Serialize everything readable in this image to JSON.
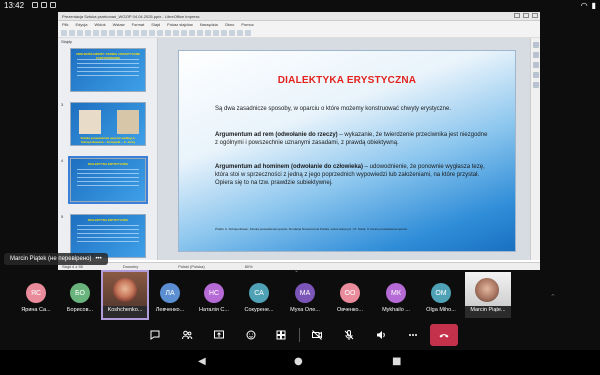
{
  "status_bar": {
    "time": "13:42"
  },
  "shared_window": {
    "title": "Prezentacja Sztuka przekonań_WOZIP 04.04.2025.pptx - LibreOffice Impress",
    "menu": [
      "Plik",
      "Edycja",
      "Widok",
      "Wstaw",
      "Format",
      "Slajd",
      "Pokaz slajdów",
      "Narzędzia",
      "Okno",
      "Pomoc"
    ],
    "slides_label": "Slajdy",
    "thumbs": [
      {
        "num": "",
        "title": "ZDOLNOŚCI MOWY: TEORIA I PRAKTYCZNE ZASTOSOWANIE"
      },
      {
        "num": "3",
        "title": "Sztuka prowadzenia sporów według A. Schopenhauera – Konspekt – A. Jarzy"
      },
      {
        "num": "4",
        "title": "DIALEKTYKA ERYSTYCZNA"
      },
      {
        "num": "5",
        "title": "DIALEKTYKA ERYSTYCZNA"
      }
    ],
    "slide": {
      "title": "DIALEKTYKA ERYSTYCZNA",
      "para1": "Są dwa zasadnicze sposoby, w oparciu o które możemy konstruować chwyty erystyczne.",
      "para2_bold": "Argumentum ad rem (odwołanie do rzeczy)",
      "para2_rest": " – wykazanie, że twierdzenie przeciwnika jest niezgodne z ogólnymi i powszechnie uznanymi zasadami, z prawdą obiektywną.",
      "para3_bold": "Argumentum ad hominem (odwołanie do człowieka)",
      "para3_rest": " – udowodnienie, że ponownie wygłasza tezę, która stoi w sprzeczności z jedną z jego poprzednich wypowiedzi lub założeniami, na które przystał. Opiera się to na tzw. prawdzie subiektywnej.",
      "footnote": "Źródło: A. Schopenhauer, Sztuka prowadzenia sporów, Fundacja Nowoczesna Polska, wolne lektury.pl ; M. Sokół, O sztuce prowadzenia sporów"
    },
    "status": [
      "Slajd 4 z 55",
      "Dowolny",
      "Polski (Polska)",
      "80%"
    ]
  },
  "speaker_tooltip": {
    "name": "Marcin Piątek (не перевірено)",
    "more": "•••"
  },
  "participants": [
    {
      "initials": "ЯС",
      "name": "Ярина Са...",
      "color": "#e98b9a",
      "type": "avatar"
    },
    {
      "initials": "БО",
      "name": "Борисов...",
      "color": "#69b37c",
      "type": "avatar"
    },
    {
      "initials": "",
      "name": "Koshchenko...",
      "color": "",
      "type": "video-active"
    },
    {
      "initials": "ЛА",
      "name": "Левченко...",
      "color": "#5b8fd1",
      "type": "avatar"
    },
    {
      "initials": "НС",
      "name": "Наталія С...",
      "color": "#b56ad6",
      "type": "avatar"
    },
    {
      "initials": "СА",
      "name": "Сокурене...",
      "color": "#4fa2b5",
      "type": "avatar"
    },
    {
      "initials": "МА",
      "name": "Муха Оле...",
      "color": "#7b56b8",
      "type": "avatar"
    },
    {
      "initials": "ОО",
      "name": "Овченко...",
      "color": "#e98b9a",
      "type": "avatar"
    },
    {
      "initials": "МК",
      "name": "Mykhailo ...",
      "color": "#b56ad6",
      "type": "avatar"
    },
    {
      "initials": "ОМ",
      "name": "Olga Miho...",
      "color": "#4fa2b5",
      "type": "avatar"
    },
    {
      "initials": "",
      "name": "Marcin Piąte...",
      "color": "",
      "type": "video"
    }
  ],
  "controls": [
    "chat",
    "people",
    "share",
    "reactions",
    "more-apps",
    "camera-off",
    "mic-off",
    "speaker",
    "more",
    "hang-up"
  ]
}
